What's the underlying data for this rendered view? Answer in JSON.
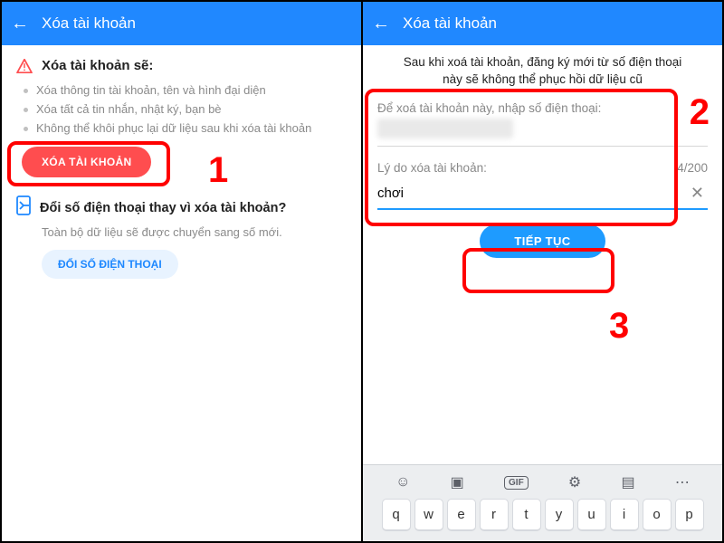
{
  "left": {
    "header": {
      "title": "Xóa tài khoản"
    },
    "warning_title": "Xóa tài khoản sẽ:",
    "bullets": [
      "Xóa thông tin tài khoản, tên và hình đại diện",
      "Xóa tất cả tin nhắn, nhật ký, bạn bè",
      "Không thể khôi phục lại dữ liệu sau khi xóa tài khoản"
    ],
    "delete_button": "XÓA TÀI KHOẢN",
    "change_title": "Đổi số điện thoại thay vì xóa tài khoản?",
    "change_sub": "Toàn bộ dữ liệu sẽ được chuyển sang số mới.",
    "change_button": "ĐỔI SỐ ĐIỆN THOẠI"
  },
  "right": {
    "header": {
      "title": "Xóa tài khoản"
    },
    "notice": "Sau khi xoá tài khoản, đăng ký mới từ số điện thoại này sẽ không thể phục hồi dữ liệu cũ",
    "phone_label": "Để xoá tài khoản này, nhập số điện thoại:",
    "reason_label": "Lý do xóa tài khoản:",
    "reason_count": "4/200",
    "reason_value": "chơi",
    "continue_button": "TIẾP TỤC"
  },
  "keyboard": {
    "rows": [
      [
        "q",
        "w",
        "e",
        "r",
        "t",
        "y",
        "u",
        "i",
        "o",
        "p"
      ]
    ]
  },
  "annotations": {
    "n1": "1",
    "n2": "2",
    "n3": "3"
  }
}
